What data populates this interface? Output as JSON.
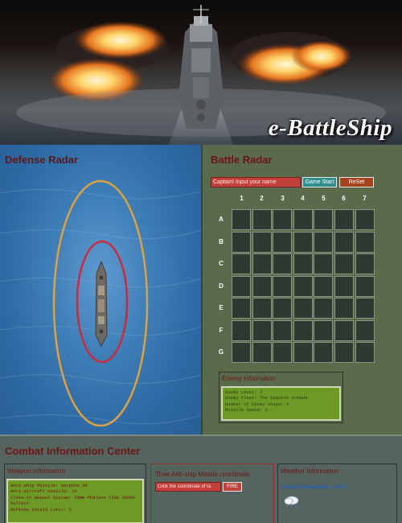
{
  "header": {
    "title": "e-BattleShip"
  },
  "defense_radar": {
    "title": "Defense Radar"
  },
  "battle_radar": {
    "title": "Battle Radar",
    "name_placeholder": "Captain! Input your name",
    "start_label": "Game Start",
    "reset_label": "ReSet",
    "columns": [
      "1",
      "2",
      "3",
      "4",
      "5",
      "6",
      "7"
    ],
    "rows": [
      "A",
      "B",
      "C",
      "D",
      "E",
      "F",
      "G"
    ],
    "enemy_info": {
      "title": "Enemy information",
      "lines": [
        "Enemy Level: 2",
        "Enemy Fleet: The Spanish Armada",
        "Number of Enemy ships: 4",
        "Missile Speed: 3"
      ]
    }
  },
  "cic": {
    "title": "Combat Information Center",
    "weapon": {
      "title": "Weapon Information",
      "lines": [
        "Anti-ship Missile: Harpoon 30",
        "Anti-aircraft missile: 20",
        "Close-in Weapon System: 20mm Phalanx CIWS 30000",
        "bullets",
        "Defense shield Limit: 5"
      ]
    },
    "missile": {
      "title": "Thee Anti-ship Missile coordinate",
      "coord_placeholder": "Click the coordinate of ta",
      "fire_label": "FIRE"
    },
    "weather": {
      "title": "Weather Information",
      "temperature": "Current Temperature: -4.0°C",
      "icon": "snow-cloud-icon"
    }
  },
  "colors": {
    "panel_green": "#5a6b4c",
    "grid_cell": "#303931",
    "title_red": "#6b1616",
    "input_red": "#c2413c",
    "info_green": "#6d9a26",
    "start_teal": "#2f8f8c",
    "reset_orange": "#a5441c",
    "radar_outer": "#e0a040",
    "radar_inner": "#cc2a3a"
  }
}
